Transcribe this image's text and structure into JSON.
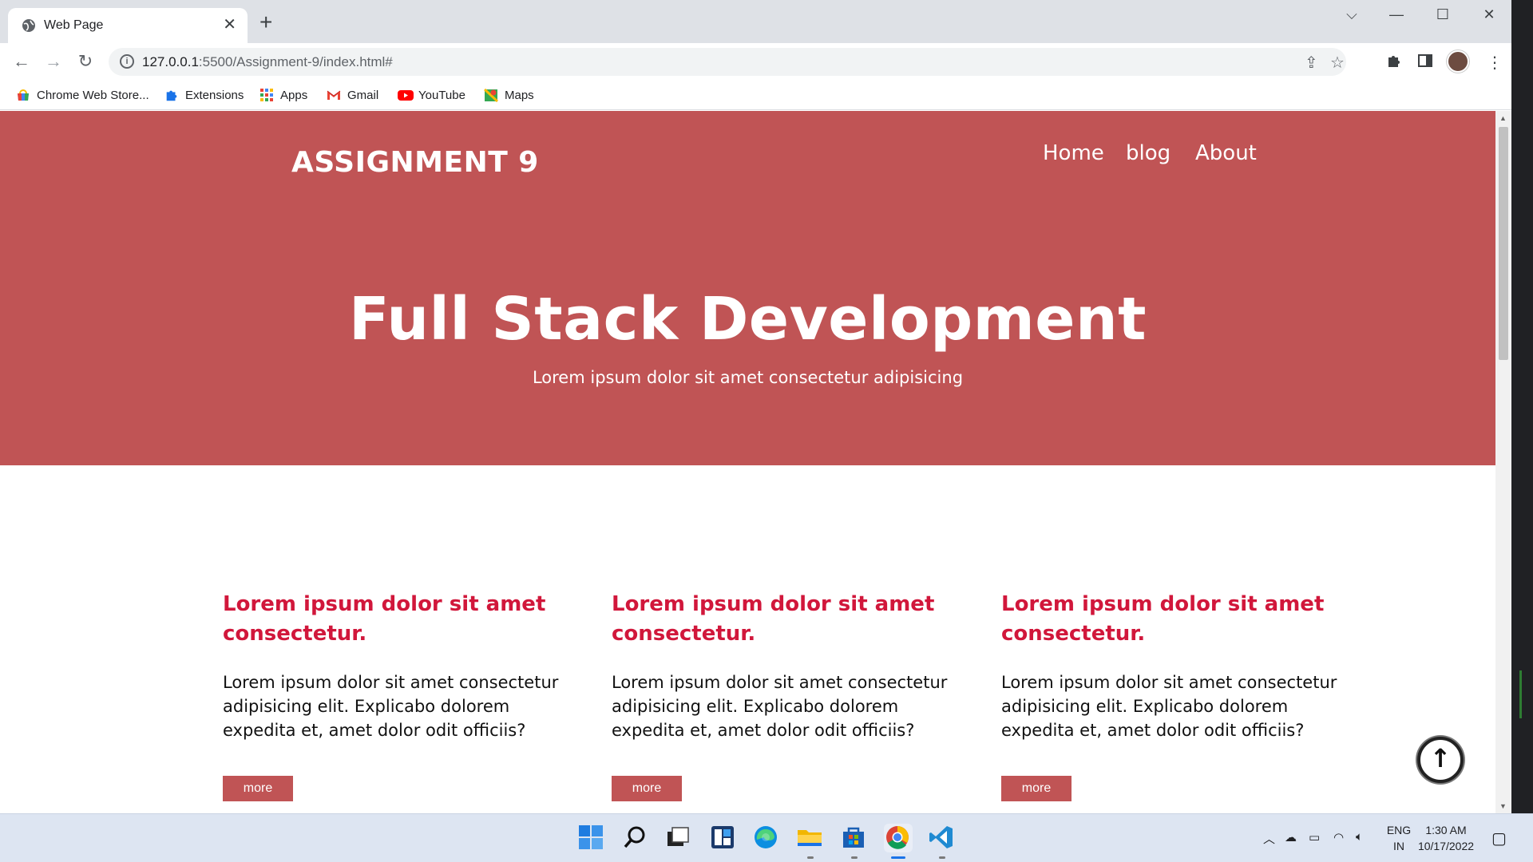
{
  "browser": {
    "tab_title": "Web Page",
    "url_host": "127.0.0.1",
    "url_rest": ":5500/Assignment-9/index.html#",
    "bookmarks": [
      {
        "label": "Chrome Web Store...",
        "icon": "chrome-web-store-icon"
      },
      {
        "label": "Extensions",
        "icon": "puzzle-icon"
      },
      {
        "label": "Apps",
        "icon": "apps-grid-icon"
      },
      {
        "label": "Gmail",
        "icon": "gmail-icon"
      },
      {
        "label": "YouTube",
        "icon": "youtube-icon"
      },
      {
        "label": "Maps",
        "icon": "maps-icon"
      }
    ]
  },
  "site": {
    "logo": "ASSIGNMENT 9",
    "nav": [
      "Home",
      "blog",
      "About"
    ],
    "hero_title": "Full Stack Development",
    "hero_subtitle": "Lorem ipsum dolor sit amet consectetur adipisicing",
    "cards": [
      {
        "title": "Lorem ipsum dolor sit amet consectetur.",
        "body": "Lorem ipsum dolor sit amet consectetur adipisicing elit. Explicabo dolorem expedita et, amet dolor odit officiis?",
        "button": "more"
      },
      {
        "title": "Lorem ipsum dolor sit amet consectetur.",
        "body": "Lorem ipsum dolor sit amet consectetur adipisicing elit. Explicabo dolorem expedita et, amet dolor odit officiis?",
        "button": "more"
      },
      {
        "title": "Lorem ipsum dolor sit amet consectetur.",
        "body": "Lorem ipsum dolor sit amet consectetur adipisicing elit. Explicabo dolorem expedita et, amet dolor odit officiis?",
        "button": "more"
      }
    ],
    "scroll_top_icon": "arrow-up-icon",
    "hero_color": "#c05455",
    "card_title_color": "#d1173b"
  },
  "taskbar": {
    "language_line1": "ENG",
    "language_line2": "IN",
    "time": "1:30 AM",
    "date": "10/17/2022"
  }
}
